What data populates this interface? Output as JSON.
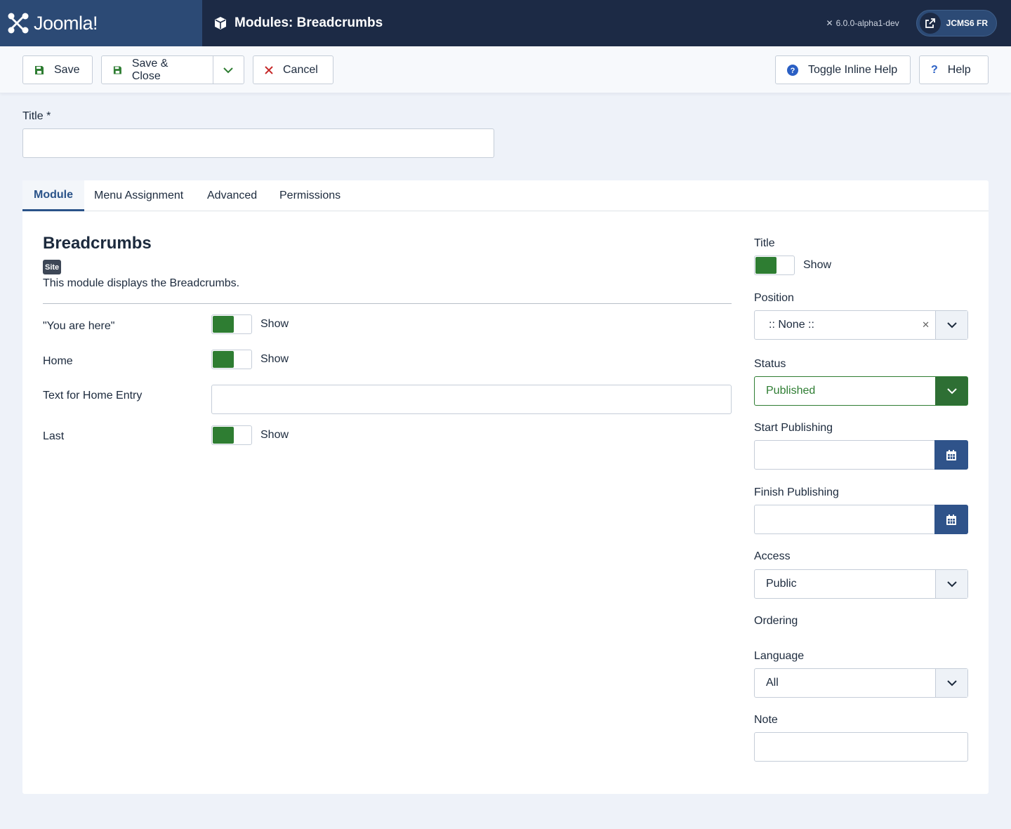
{
  "header": {
    "logo_text": "Joomla!",
    "page_title": "Modules: Breadcrumbs",
    "version": "6.0.0-alpha1-dev",
    "site_name": "JCMS6 FR"
  },
  "toolbar": {
    "save_label": "Save",
    "save_close_label": "Save & Close",
    "cancel_label": "Cancel",
    "toggle_help_label": "Toggle Inline Help",
    "help_label": "Help"
  },
  "title_field": {
    "label": "Title *",
    "value": ""
  },
  "tabs": [
    {
      "label": "Module",
      "active": true
    },
    {
      "label": "Menu Assignment",
      "active": false
    },
    {
      "label": "Advanced",
      "active": false
    },
    {
      "label": "Permissions",
      "active": false
    }
  ],
  "module": {
    "name": "Breadcrumbs",
    "badge": "Site",
    "description": "This module displays the Breadcrumbs."
  },
  "options": {
    "you_are_here": {
      "label": "\"You are here\"",
      "state": "Show"
    },
    "home": {
      "label": "Home",
      "state": "Show"
    },
    "home_text": {
      "label": "Text for Home Entry",
      "value": ""
    },
    "last": {
      "label": "Last",
      "state": "Show"
    }
  },
  "sidebar": {
    "title": {
      "label": "Title",
      "state": "Show"
    },
    "position": {
      "label": "Position",
      "value": ":: None ::"
    },
    "status": {
      "label": "Status",
      "value": "Published"
    },
    "start_publishing": {
      "label": "Start Publishing",
      "value": ""
    },
    "finish_publishing": {
      "label": "Finish Publishing",
      "value": ""
    },
    "access": {
      "label": "Access",
      "value": "Public"
    },
    "ordering": {
      "label": "Ordering"
    },
    "language": {
      "label": "Language",
      "value": "All"
    },
    "note": {
      "label": "Note",
      "value": ""
    }
  },
  "colors": {
    "header_bg": "#1c2a45",
    "logo_bg": "#2c4a75",
    "toggle_on": "#2e7d32",
    "status_green": "#2e7d32",
    "accent_blue": "#2a5389"
  }
}
